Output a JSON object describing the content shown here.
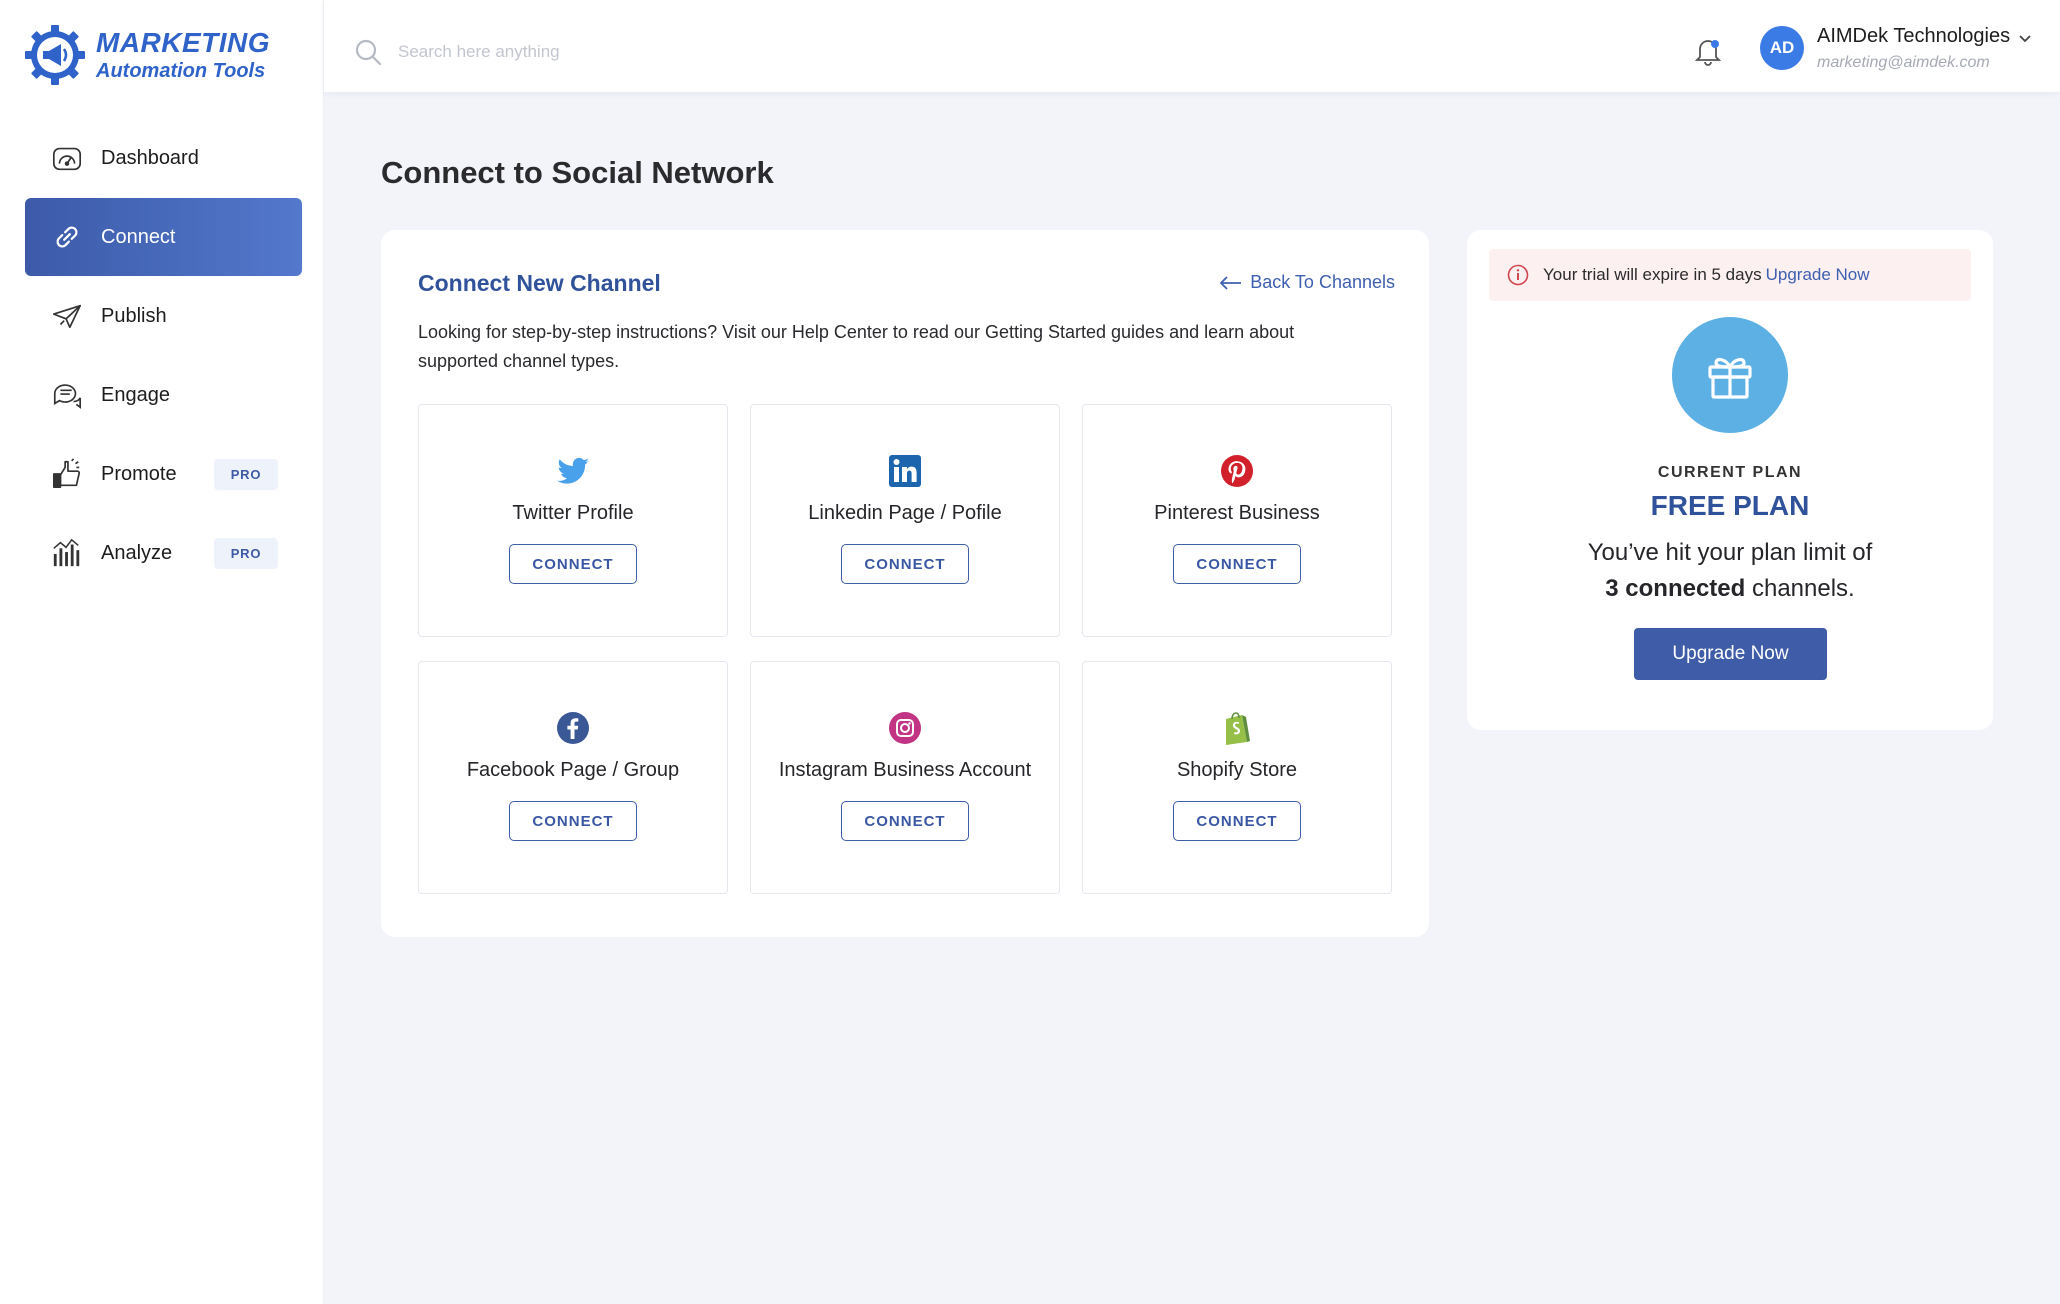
{
  "brand": {
    "line1": "MARKETING",
    "line2": "Automation Tools",
    "color": "#2f63c9"
  },
  "sidebar": {
    "items": [
      {
        "label": "Dashboard",
        "icon": "dashboard-icon",
        "active": false
      },
      {
        "label": "Connect",
        "icon": "link-icon",
        "active": true
      },
      {
        "label": "Publish",
        "icon": "paper-plane-icon",
        "active": false
      },
      {
        "label": "Engage",
        "icon": "chat-bubbles-icon",
        "active": false
      },
      {
        "label": "Promote",
        "icon": "thumbs-up-icon",
        "active": false,
        "badge": "PRO"
      },
      {
        "label": "Analyze",
        "icon": "bar-chart-icon",
        "active": false,
        "badge": "PRO"
      }
    ]
  },
  "header": {
    "search_placeholder": "Search here anything",
    "user": {
      "initials": "AD",
      "name": "AIMDek Technologies",
      "email": "marketing@aimdek.com"
    }
  },
  "page": {
    "title": "Connect to Social Network"
  },
  "connect_card": {
    "title": "Connect New Channel",
    "back_label": "Back To Channels",
    "description": "Looking for step-by-step instructions? Visit our Help Center to read our Getting Started guides and learn about supported channel types.",
    "channels": [
      {
        "label": "Twitter Profile",
        "icon": "twitter-icon",
        "button": "CONNECT",
        "color": "#4aa1eb"
      },
      {
        "label": "Linkedin Page / Pofile",
        "icon": "linkedin-icon",
        "button": "CONNECT",
        "color": "#1d66ad"
      },
      {
        "label": "Pinterest Business",
        "icon": "pinterest-icon",
        "button": "CONNECT",
        "color": "#d2212b"
      },
      {
        "label": "Facebook Page / Group",
        "icon": "facebook-icon",
        "button": "CONNECT",
        "color": "#3a5796"
      },
      {
        "label": "Instagram Business Account",
        "icon": "instagram-icon",
        "button": "CONNECT",
        "color": "#c13584"
      },
      {
        "label": "Shopify Store",
        "icon": "shopify-icon",
        "button": "CONNECT",
        "color": "#95bf47"
      }
    ]
  },
  "plan_card": {
    "trial_text": "Your trial will expire in 5 days",
    "trial_link": "Upgrade Now",
    "caption": "CURRENT PLAN",
    "plan_name": "FREE PLAN",
    "message_line1": "You’ve hit your plan limit of",
    "message_bold": "3 connected",
    "message_tail": " channels.",
    "button": "Upgrade Now"
  }
}
